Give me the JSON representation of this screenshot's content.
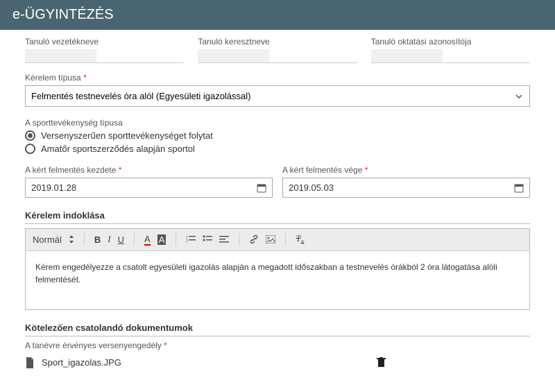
{
  "header": {
    "title": "e-ÜGYINTÉZÉS"
  },
  "student": {
    "lastname_label": "Tanuló vezetékneve",
    "firstname_label": "Tanuló keresztneve",
    "id_label": "Tanuló oktatási azonosítója",
    "lastname": "",
    "firstname": "",
    "id": ""
  },
  "request_type": {
    "label": "Kérelem típusa",
    "value": "Felmentés testnevelés óra alól (Egyesületi igazolással)"
  },
  "sport": {
    "label": "A sporttevékenység típusa",
    "option1": "Versenyszerűen sporttevékenységet folytat",
    "option2": "Amatőr sportszerződés alapján sportol",
    "selected": 0
  },
  "dates": {
    "start_label": "A kért felmentés kezdete",
    "end_label": "A kért felmentés vége",
    "start": "2019.01.28",
    "end": "2019.05.03"
  },
  "reason": {
    "heading": "Kérelem indoklása",
    "style_label": "Normál",
    "body": "Kérem engedélyezze a csatolt egyesületi igazolás alapján a megadott időszakban a testnevelés órákból 2 óra látogatása alóli felmentését."
  },
  "attachments": {
    "heading": "Kötelezően csatolandó dokumentumok",
    "label": "A tanévre érvényes versenyengedély",
    "file": "Sport_igazolas.JPG"
  }
}
